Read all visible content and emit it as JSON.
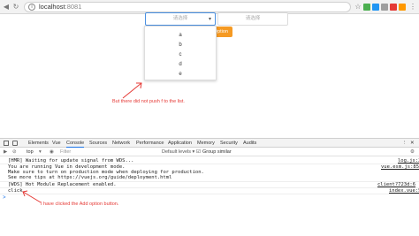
{
  "browser": {
    "url_host": "localhost",
    "url_port": ":8081"
  },
  "page": {
    "select1_placeholder": "请选择",
    "select2_placeholder": "请选择",
    "add_button_label": "Option",
    "options": [
      "a",
      "b",
      "c",
      "d",
      "e"
    ],
    "annotation_top": "But there did not push f to the list."
  },
  "devtools": {
    "tabs": [
      "Elements",
      "Vue",
      "Console",
      "Sources",
      "Network",
      "Performance",
      "Application",
      "Memory",
      "Security",
      "Audits"
    ],
    "active_tab": "Console",
    "context": "top",
    "filter_placeholder": "Filter",
    "levels": "Default levels ▾",
    "group_similar": "Group similar",
    "logs": [
      {
        "text": "[HMR] Waiting for update signal from WDS...",
        "src": "log.js:2"
      },
      {
        "text": "You are running Vue in development mode.",
        "src": "vue.esm.js:856"
      },
      {
        "text": "Make sure to turn on production mode when deploying for production.",
        "src": ""
      },
      {
        "text": "See more tips at https://vuejs.org/guide/deployment.html",
        "src": ""
      },
      {
        "text": "[WDS] Hot Module Replacement enabled.",
        "src": "client?723d:6"
      },
      {
        "text": "click",
        "src": "index.vue:5"
      }
    ],
    "prompt": ">",
    "annotation_bottom": "I have clicked the Add option button."
  },
  "colors": {
    "accent": "#f59a23",
    "annotation": "#e53935",
    "focus": "#4a90e2"
  }
}
